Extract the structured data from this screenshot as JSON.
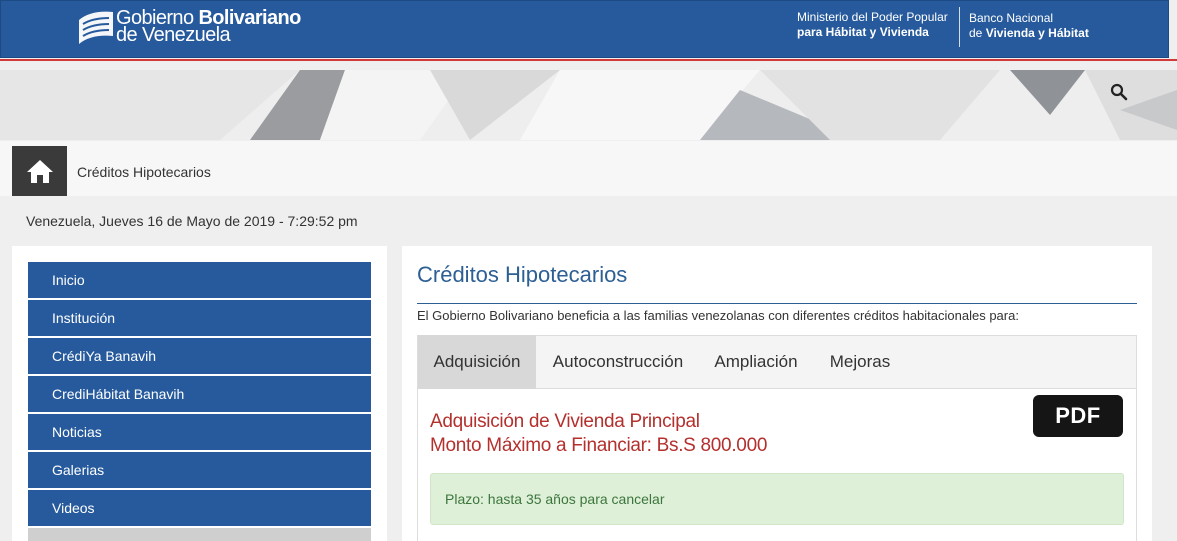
{
  "header": {
    "gob_line1_light": "Gobierno ",
    "gob_line1_bold": "Bolivariano",
    "gob_line2": "de Venezuela",
    "ministry_line1": "Ministerio del Poder Popular",
    "ministry_line2": "para Hábitat y Vivienda",
    "banco_line1": "Banco Nacional",
    "banco_line2_light": "de ",
    "banco_line2_bold": "Vivienda y Hábitat",
    "brand_color": "#265a9c",
    "accent_color": "#d23a3a"
  },
  "banner": {
    "search_icon": "search-icon"
  },
  "breadcrumb": {
    "home_icon": "home-icon",
    "label": "Créditos Hipotecarios"
  },
  "datetime": "Venezuela, Jueves 16 de Mayo de 2019 - 7:29:52 pm",
  "sidebar": {
    "items": [
      {
        "label": "Inicio"
      },
      {
        "label": "Institución"
      },
      {
        "label": "CrédiYa Banavih"
      },
      {
        "label": "CrediHábitat Banavih"
      },
      {
        "label": "Noticias"
      },
      {
        "label": "Galerias"
      },
      {
        "label": "Videos"
      }
    ]
  },
  "main": {
    "title": "Créditos Hipotecarios",
    "intro": "El Gobierno Bolivariano beneficia a las familias venezolanas con diferentes créditos habitacionales para:",
    "tabs": [
      {
        "label": "Adquisición",
        "active": true
      },
      {
        "label": "Autoconstrucción"
      },
      {
        "label": "Ampliación"
      },
      {
        "label": "Mejoras"
      }
    ],
    "panel": {
      "title": "Adquisición de Vivienda Principal",
      "amount": "Monto Máximo a Financiar: Bs.S 800.000",
      "pdf_label": "PDF",
      "alert": "Plazo: hasta 35 años para cancelar"
    }
  }
}
